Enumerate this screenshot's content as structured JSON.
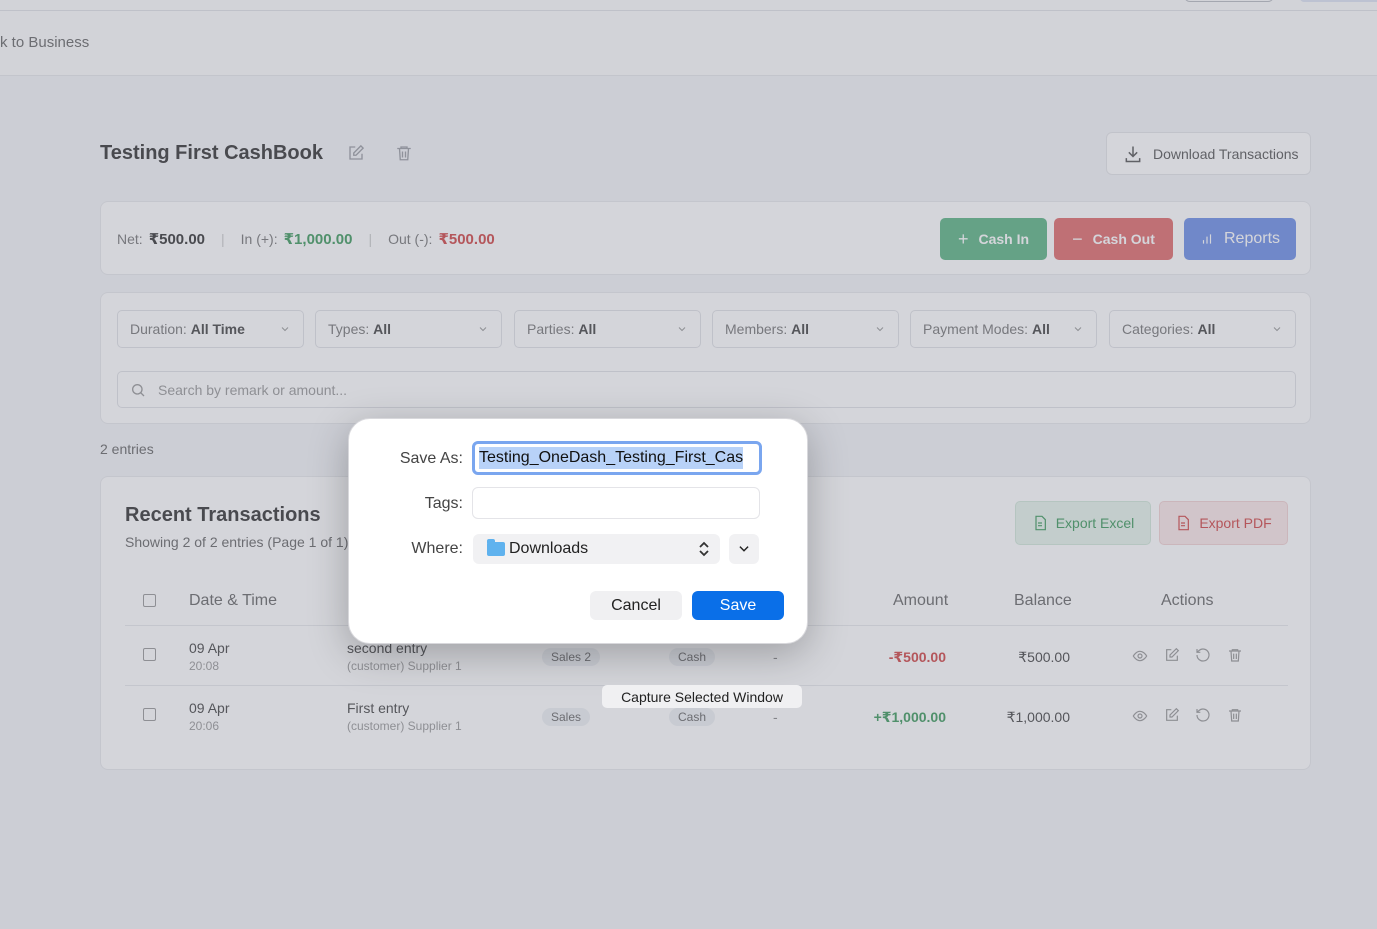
{
  "topbar": {
    "back_label": "k to Business"
  },
  "header": {
    "title": "Testing First CashBook",
    "download_label": "Download Transactions"
  },
  "summary": {
    "net_label": "Net:",
    "net_value": "₹500.00",
    "in_label": "In (+):",
    "in_value": "₹1,000.00",
    "out_label": "Out (-):",
    "out_value": "₹500.00",
    "cash_in_label": "Cash In",
    "cash_out_label": "Cash Out",
    "reports_label": "Reports",
    "colors": {
      "in": "#5cb483",
      "out": "#e06a6a",
      "reports": "#6c8ee6"
    }
  },
  "filters": {
    "items": [
      {
        "label": "Duration:",
        "value": "All Time"
      },
      {
        "label": "Types:",
        "value": "All"
      },
      {
        "label": "Parties:",
        "value": "All"
      },
      {
        "label": "Members:",
        "value": "All"
      },
      {
        "label": "Payment Modes:",
        "value": "All"
      },
      {
        "label": "Categories:",
        "value": "All"
      }
    ],
    "search_placeholder": "Search by remark or amount..."
  },
  "entries_count": "2 entries",
  "transactions": {
    "title": "Recent Transactions",
    "subtitle": "Showing 2 of 2 entries (Page 1 of 1)",
    "export_excel": "Export Excel",
    "export_pdf": "Export PDF",
    "columns": [
      "Date & Time",
      "Amount",
      "Balance",
      "Actions"
    ],
    "rows": [
      {
        "date": "09 Apr",
        "time": "20:08",
        "remark": "second entry",
        "party": "(customer) Supplier 1",
        "category": "Sales 2",
        "mode": "Cash",
        "dash": "-",
        "amount": "-₹500.00",
        "balance": "₹500.00",
        "type": "out"
      },
      {
        "date": "09 Apr",
        "time": "20:06",
        "remark": "First entry",
        "party": "(customer) Supplier 1",
        "category": "Sales",
        "mode": "Cash",
        "dash": "-",
        "amount": "+₹1,000.00",
        "balance": "₹1,000.00",
        "type": "in"
      }
    ]
  },
  "dialog": {
    "save_as_label": "Save As:",
    "save_as_value": "Testing_OneDash_Testing_First_Cas",
    "tags_label": "Tags:",
    "where_label": "Where:",
    "where_value": "Downloads",
    "cancel_label": "Cancel",
    "save_label": "Save"
  },
  "tooltip": "Capture Selected Window"
}
